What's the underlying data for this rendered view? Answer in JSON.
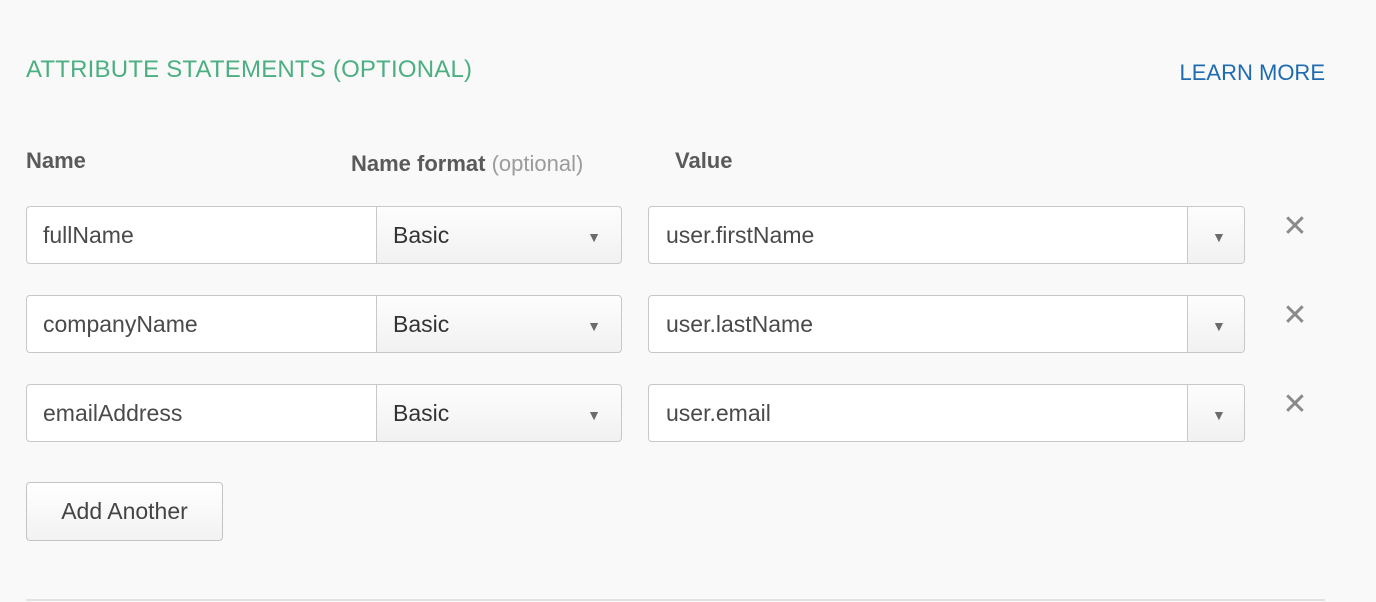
{
  "section": {
    "title": "ATTRIBUTE STATEMENTS (OPTIONAL)",
    "learn_more": "LEARN MORE"
  },
  "columns": {
    "name": "Name",
    "name_format": "Name format",
    "name_format_optional": "(optional)",
    "value": "Value"
  },
  "rows": [
    {
      "name": "fullName",
      "format": "Basic",
      "value": "user.firstName"
    },
    {
      "name": "companyName",
      "format": "Basic",
      "value": "user.lastName"
    },
    {
      "name": "emailAddress",
      "format": "Basic",
      "value": "user.email"
    }
  ],
  "icons": {
    "dropdown": "▼",
    "remove": "✕"
  },
  "actions": {
    "add_another": "Add Another"
  },
  "colors": {
    "title": "#4caf82",
    "link": "#1f6bb0",
    "background": "#f9f9f9"
  }
}
